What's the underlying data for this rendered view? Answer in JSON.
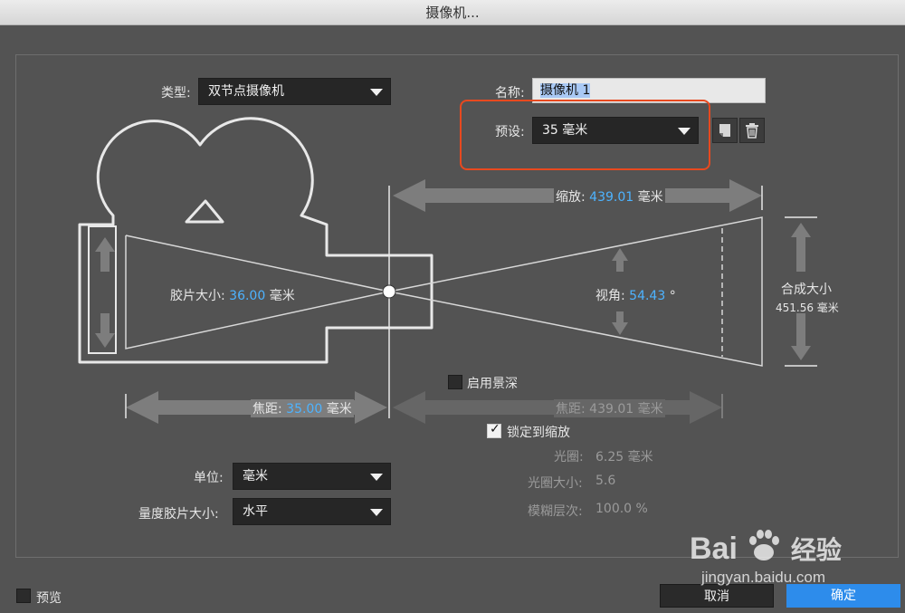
{
  "window": {
    "title": "摄像机..."
  },
  "type_field": {
    "label": "类型:",
    "value": "双节点摄像机"
  },
  "name_field": {
    "label": "名称:",
    "value": "摄像机 1"
  },
  "preset_field": {
    "label": "预设:",
    "value": "35 毫米"
  },
  "diagram": {
    "zoom": {
      "label": "缩放:",
      "value": "439.01",
      "unit": "毫米"
    },
    "film_size": {
      "label": "胶片大小:",
      "value": "36.00",
      "unit": "毫米"
    },
    "angle": {
      "label": "视角:",
      "value": "54.43",
      "unit": "°"
    },
    "composition_size": {
      "label": "合成大小",
      "value": "451.56 毫米"
    },
    "focal_length": {
      "label": "焦距:",
      "value": "35.00",
      "unit": "毫米"
    }
  },
  "depth_of_field": {
    "enable_label": "启用景深",
    "enabled": false,
    "focus_distance": {
      "label": "焦距:",
      "value": "439.01 毫米"
    },
    "lock_label": "锁定到缩放",
    "locked": true,
    "aperture": {
      "label": "光圈:",
      "value": "6.25 毫米"
    },
    "f_stop": {
      "label": "光圈大小:",
      "value": "5.6"
    },
    "blur_level": {
      "label": "模糊层次:",
      "value": "100.0 %"
    }
  },
  "units_field": {
    "label": "单位:",
    "value": "毫米"
  },
  "measure_film_field": {
    "label": "量度胶片大小:",
    "value": "水平"
  },
  "preview": {
    "label": "预览",
    "checked": false
  },
  "buttons": {
    "cancel": "取消",
    "ok": "确定"
  },
  "watermark": {
    "brand": "Bai",
    "brand2": "经验",
    "url": "jingyan.baidu.com"
  },
  "colors": {
    "accent": "#4db3ff",
    "highlight_box": "#e8491f",
    "ok_button": "#2d8ceb"
  },
  "icons": [
    "chevron-down-icon",
    "new-preset-icon",
    "trash-icon",
    "checkmark-icon",
    "paw-icon"
  ]
}
